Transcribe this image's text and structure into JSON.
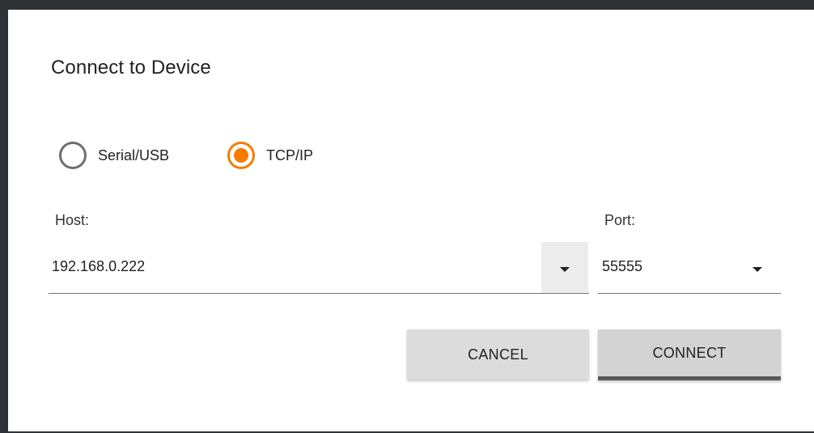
{
  "dialog": {
    "title": "Connect to Device"
  },
  "connection_type": {
    "options": [
      {
        "label": "Serial/USB",
        "selected": false
      },
      {
        "label": "TCP/IP",
        "selected": true
      }
    ]
  },
  "host": {
    "label": "Host:",
    "value": "192.168.0.222"
  },
  "port": {
    "label": "Port:",
    "value": "55555"
  },
  "buttons": {
    "cancel_label": "CANCEL",
    "connect_label": "CONNECT"
  },
  "colors": {
    "accent": "#f57c00",
    "button_bg": "#dcdcdc",
    "frame": "#2f3337"
  },
  "icons": {
    "dropdown": "caret-down-icon"
  }
}
